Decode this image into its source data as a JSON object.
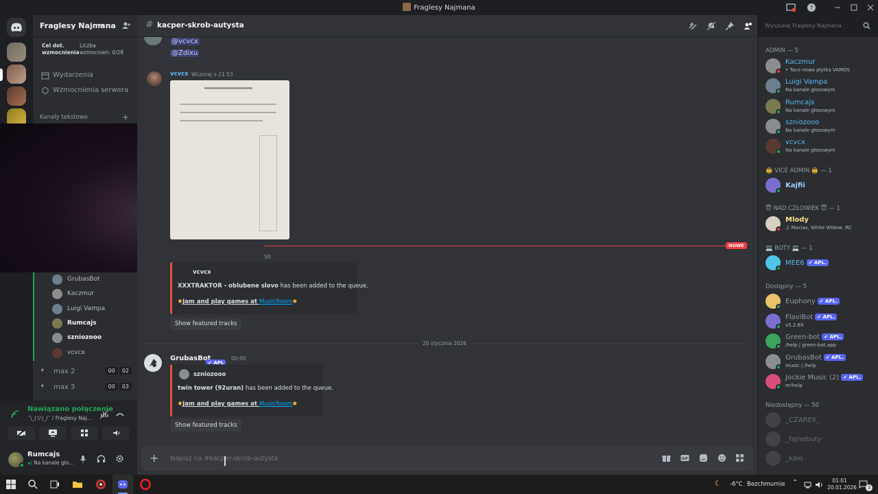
{
  "window": {
    "title": "Fraglesy Najmana"
  },
  "server": {
    "name": "Fraglesy Najmana",
    "boost_goal_label": "Cel dot. wzmocnienia",
    "boost_count_label": "Liczba wzmocnień: 0/28",
    "events": "Wydarzenia",
    "boosts": "Wzmocnienia serwera",
    "text_channels": "Kanały tekstowe",
    "voice_users": [
      "GrubasBot",
      "Kaczmur",
      "Luigi Vampa",
      "Rumcajs",
      "szniozooo",
      "vcvcx"
    ],
    "voice_channels": [
      {
        "name": "max 2",
        "a": "00",
        "b": "02"
      },
      {
        "name": "max 3",
        "a": "00",
        "b": "03"
      }
    ]
  },
  "voice_status": {
    "title": "Nawiązano połączenie",
    "subtitle": "¯\\_(ツ)_/¯ / Fraglesy Naj..."
  },
  "user": {
    "name": "Rumcajs",
    "status": "Na kanale gło..."
  },
  "channel": {
    "name": "kacper-skrob-autysta",
    "search_placeholder": "Wyszukaj Fraglesy Najmana"
  },
  "messages": {
    "mention1": "@vcvcx",
    "mention2": "@Zdixu",
    "author1": "vcvcx",
    "time1": "Wczoraj o 21:53",
    "new_label": "NOWE",
    "embed1_user": "vcvcx",
    "embed1_track": "XXXTRAKTOR - oblubene slovo",
    "embed1_suffix": " has been added to the queue.",
    "embed_promo_pre": "Jam and play games at ",
    "embed_promo_link": "MusicRoom",
    "featured": "Show featured tracks",
    "time_cut": "50",
    "date_divider": "20 stycznia 2026",
    "author2": "GrubasBot",
    "author2_tag": "APL",
    "time2": "00:00",
    "embed2_user": "szniozooo",
    "embed2_track": "twin tower (92uran)",
    "embed2_suffix": " has been added to the queue."
  },
  "composer": {
    "placeholder": "Napisz na #kacper-skrob-autysta"
  },
  "members": {
    "admin": "ADMIN — 5",
    "admins": [
      {
        "name": "Kaczmur",
        "status": "• Taco nowa płytka VAMOS",
        "color": "#5ab8f0",
        "av": "#8e8e8e"
      },
      {
        "name": "Luigi Vampa",
        "status": "Na kanale głosowym",
        "color": "#5ab8f0",
        "av": "#6d7f8f"
      },
      {
        "name": "Rumcajs",
        "status": "Na kanale głosowym",
        "color": "#5ab8f0",
        "av": "#7b7a4f"
      },
      {
        "name": "szniozooo",
        "status": "Na kanale głosowym",
        "color": "#5ab8f0",
        "av": "#8a8d8f"
      },
      {
        "name": "vcvcx",
        "status": "Na kanale głosowym",
        "color": "#5ab8f0",
        "av": "#5a3a30"
      }
    ],
    "vice": "🤠 VICE ADMIN 🤠 — 1",
    "vice_member": {
      "name": "Kajfii",
      "color": "#9ed0ff"
    },
    "nad": "😇 NAD CZŁOWIEK 😇 — 1",
    "nad_member": {
      "name": "Mlody",
      "status": "♫ Macias, White Widow, RC",
      "color": "#f5e38a"
    },
    "boty": "💻 BOTY 💻 — 1",
    "bot_member": {
      "name": "MEE6",
      "tag": "APL.",
      "color": "#5ab8f0"
    },
    "available": "Dostępny — 5",
    "available_list": [
      {
        "name": "Euphony",
        "tag": "APL.",
        "status": "",
        "av": "#e9c46a"
      },
      {
        "name": "FlaviBot",
        "tag": "APL.",
        "status": "v5.2.69",
        "av": "#7a6fd0"
      },
      {
        "name": "Green-bot",
        "tag": "APL.",
        "status": "/help | green-bot.app",
        "av": "#3aa55c"
      },
      {
        "name": "GrubasBot",
        "tag": "APL.",
        "status": "music | /help",
        "av": "#8a8d92"
      },
      {
        "name": "Jockie Music (2)",
        "tag": "APL.",
        "status": "m!help",
        "av": "#d94c7a"
      }
    ],
    "offline": "Niedostępny — 50",
    "offline_list": [
      "_CZAREK_",
      "_fajnebuty",
      "_kalo"
    ]
  },
  "taskbar": {
    "weather": "-6°C",
    "weather_text": "Bezchmurnie",
    "time": "01:01",
    "date": "20.01.2026",
    "notif": "3"
  }
}
